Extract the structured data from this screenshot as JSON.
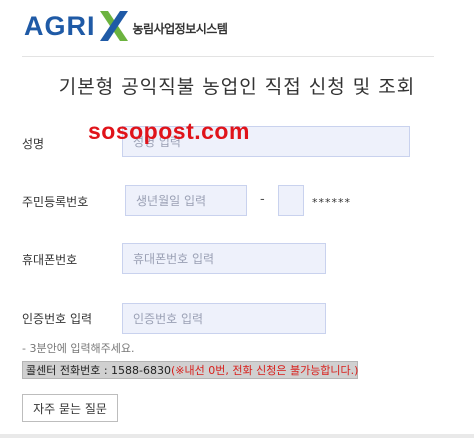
{
  "header": {
    "logo_text": "AGRI",
    "logo_subtitle": "농림사업정보시스템"
  },
  "page_title": "기본형 공익직불 농업인 직접 신청 및 조회",
  "watermark": "sosopost.com",
  "form": {
    "name": {
      "label": "성명",
      "placeholder": "성명 입력"
    },
    "resident_number": {
      "label": "주민등록번호",
      "birth_placeholder": "생년월일 입력",
      "separator": "-",
      "mask": "******"
    },
    "phone": {
      "label": "휴대폰번호",
      "placeholder": "휴대폰번호 입력"
    },
    "verification": {
      "label": "인증번호 입력",
      "placeholder": "인증번호 입력",
      "hint": "- 3분안에 입력해주세요."
    }
  },
  "call_center": {
    "label": "콜센터 전화번호 : 1588-6830",
    "warning": "(※내선 0번, 전화 신청은 불가능합니다.)"
  },
  "faq_button": "자주 묻는 질문",
  "colors": {
    "brand_blue": "#1f5aa6",
    "brand_green": "#6cb33f",
    "field_bg": "#eef1fb",
    "warning_red": "#d8201c"
  }
}
